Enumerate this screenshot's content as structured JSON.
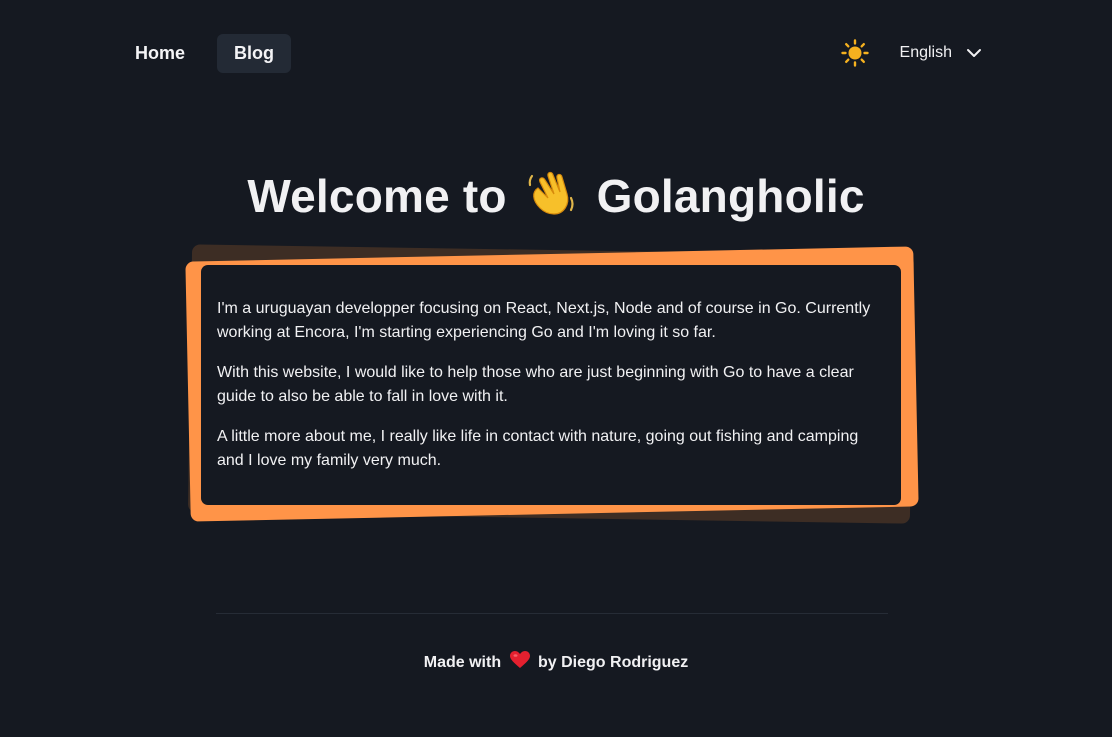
{
  "nav": {
    "links": [
      {
        "label": "Home",
        "active": false
      },
      {
        "label": "Blog",
        "active": true
      }
    ],
    "theme_icon": "sun-icon",
    "language": {
      "selected": "English",
      "icon": "chevron-down-icon"
    }
  },
  "hero": {
    "title_prefix": "Welcome to",
    "title_emoji": "waving-hand-icon",
    "title_suffix": "Golangholic"
  },
  "intro": {
    "paragraphs": [
      "I'm a uruguayan developper focusing on React, Next.js, Node and of course in Go. Currently working at Encora, I'm starting experiencing Go and I'm loving it so far.",
      "With this website, I would like to help those who are just beginning with Go to have a clear guide to also be able to fall in love with it.",
      "A little more about me, I really like life in contact with nature, going out fishing and camping and I love my family very much."
    ]
  },
  "footer": {
    "prefix": "Made with",
    "icon": "heart-icon",
    "suffix": "by Diego Rodriguez"
  },
  "colors": {
    "background": "#151921",
    "accent": "#ff9448",
    "text": "#f1f1f3",
    "nav_active_bg": "#232a35",
    "sun": "#f5b11f"
  }
}
